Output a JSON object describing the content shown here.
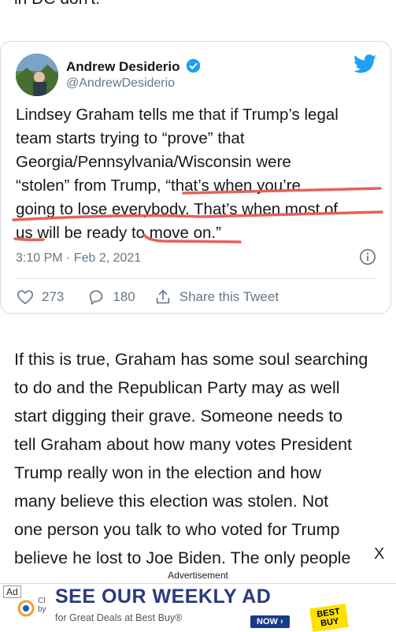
{
  "article": {
    "top_fragment": "in DC don't.",
    "paragraph_lines": [
      "If this is true, Graham has some soul searching",
      "to do and the Republican Party may as well",
      "start digging their grave.  Someone needs to",
      "tell Graham about how many votes President",
      "Trump really won in the election and how",
      "many believe this election was stolen.  Not",
      "one person you talk to who voted for Trump",
      "believe he lost to Joe Biden.  The only people"
    ]
  },
  "tweet": {
    "author_name": "Andrew Desiderio",
    "handle": "@AndrewDesiderio",
    "text_lines": [
      "Lindsey Graham tells me that if Trump’s legal",
      "team starts trying to “prove” that",
      "Georgia/Pennsylvania/Wisconsin were",
      "“stolen” from Trump, “that’s when you’re",
      "going to lose everybody. That’s when most of",
      "us will be ready to move on.”"
    ],
    "timestamp": "3:10 PM · Feb 2, 2021",
    "likes": "273",
    "replies": "180",
    "share_label": "Share this Tweet"
  },
  "ad": {
    "close_label": "X",
    "label": "Advertisement",
    "badge": "Ad",
    "adchoices_text": "Cl",
    "adchoices_by": "by",
    "headline": "SEE OUR WEEKLY AD",
    "sub": "for Great Deals at Best Buy®",
    "button": "NOW ›",
    "brand": "BEST BUY"
  },
  "colors": {
    "twitter_blue": "#1da1f2",
    "underline_red": "#e5625a",
    "muted": "#657786"
  }
}
